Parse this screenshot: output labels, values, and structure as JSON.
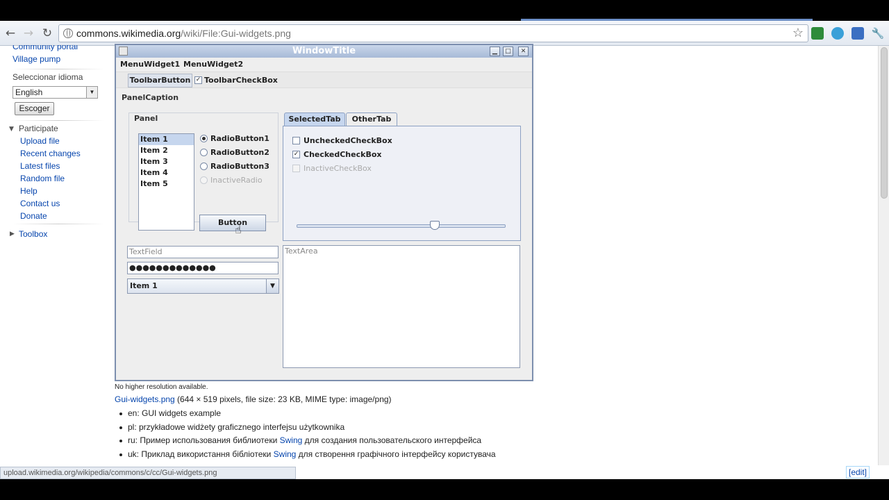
{
  "browser": {
    "url_host": "commons.wikimedia.org",
    "url_path": "/wiki/File:Gui-widgets.png",
    "status_url": "upload.wikimedia.org/wikipedia/commons/c/cc/Gui-widgets.png"
  },
  "sidebar": {
    "top_links": [
      "Community portal",
      "Village pump"
    ],
    "lang_heading": "Seleccionar idioma",
    "lang_value": "English",
    "escoger_label": "Escoger",
    "participate_heading": "Participate",
    "participate_links": [
      "Upload file",
      "Recent changes",
      "Latest files",
      "Random file",
      "Help",
      "Contact us",
      "Donate"
    ],
    "toolbox_heading": "Toolbox"
  },
  "window": {
    "title": "WindowTitle",
    "menus": [
      "MenuWidget1",
      "MenuWidget2"
    ],
    "toolbar_button": "ToolbarButton",
    "toolbar_checkbox": "ToolbarCheckBox",
    "panel_caption": "PanelCaption",
    "panel_label": "Panel",
    "list_items": [
      "Item 1",
      "Item 2",
      "Item 3",
      "Item 4",
      "Item 5"
    ],
    "radios": [
      "RadioButton1",
      "RadioButton2",
      "RadioButton3",
      "InactiveRadio"
    ],
    "button_label": "Button",
    "tabs": [
      "SelectedTab",
      "OtherTab"
    ],
    "tab_checkboxes": [
      "UncheckedCheckBox",
      "CheckedCheckBox",
      "InactiveCheckBox"
    ],
    "slider_value": 0.66,
    "textfield_text": "TextField",
    "password_text": "●●●●●●●●●●●●●",
    "combo_value": "Item 1",
    "textarea_text": "TextArea"
  },
  "fileinfo": {
    "no_higher": "No higher resolution available.",
    "file_link": "Gui-widgets.png",
    "file_details": " (644 × 519 pixels, file size: 23 KB, MIME type: image/png)",
    "descriptions": [
      {
        "prefix": "en: GUI widgets example",
        "link": "",
        "suffix": ""
      },
      {
        "prefix": "pl: przykładowe widżety graficznego interfejsu użytkownika",
        "link": "",
        "suffix": ""
      },
      {
        "prefix": "ru: Пример использования библиотеки ",
        "link": "Swing",
        "suffix": " для создания пользовательского интерфейса"
      },
      {
        "prefix": "uk: Приклад використання бібліотеки ",
        "link": "Swing",
        "suffix": " для створення графічного інтерфейсу користувача"
      }
    ],
    "edit_label": "[edit]"
  }
}
